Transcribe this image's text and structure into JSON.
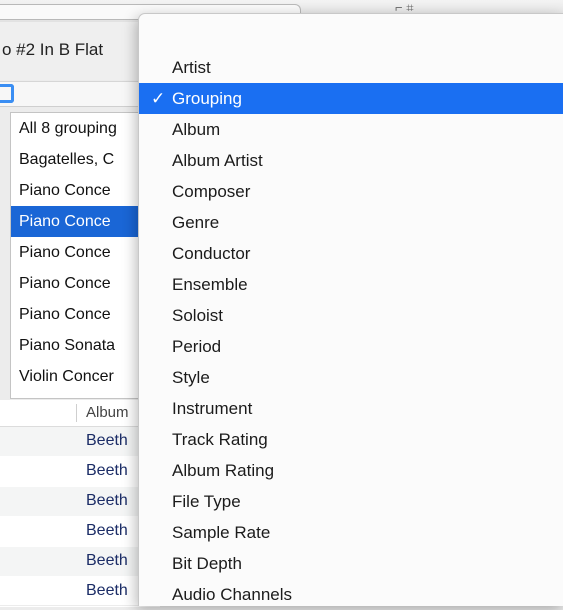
{
  "now_playing": {
    "text": "o #2 In B Flat"
  },
  "grouping_list": {
    "items": [
      {
        "label": "All 8 grouping",
        "selected": false
      },
      {
        "label": "Bagatelles, C",
        "selected": false
      },
      {
        "label": "Piano Conce",
        "selected": false
      },
      {
        "label": "Piano Conce",
        "selected": true
      },
      {
        "label": "Piano Conce",
        "selected": false
      },
      {
        "label": "Piano Conce",
        "selected": false
      },
      {
        "label": "Piano Conce",
        "selected": false
      },
      {
        "label": "Piano Sonata",
        "selected": false
      },
      {
        "label": "Violin Concer",
        "selected": false
      }
    ]
  },
  "tracks": {
    "column_header": "Album",
    "rows": [
      "Beeth",
      "Beeth",
      "Beeth",
      "Beeth",
      "Beeth",
      "Beeth"
    ]
  },
  "menu": {
    "check_glyph": "✓",
    "items": [
      {
        "label": "Artist",
        "checked": false
      },
      {
        "label": "Grouping",
        "checked": true
      },
      {
        "label": "Album",
        "checked": false
      },
      {
        "label": "Album Artist",
        "checked": false
      },
      {
        "label": "Composer",
        "checked": false
      },
      {
        "label": "Genre",
        "checked": false
      },
      {
        "label": "Conductor",
        "checked": false
      },
      {
        "label": "Ensemble",
        "checked": false
      },
      {
        "label": "Soloist",
        "checked": false
      },
      {
        "label": "Period",
        "checked": false
      },
      {
        "label": "Style",
        "checked": false
      },
      {
        "label": "Instrument",
        "checked": false
      },
      {
        "label": "Track Rating",
        "checked": false
      },
      {
        "label": "Album Rating",
        "checked": false
      },
      {
        "label": "File Type",
        "checked": false
      },
      {
        "label": "Sample Rate",
        "checked": false
      },
      {
        "label": "Bit Depth",
        "checked": false
      },
      {
        "label": "Audio Channels",
        "checked": false
      }
    ]
  },
  "colors": {
    "selection": "#1a66d6",
    "menu_highlight": "#1a6ff2",
    "focus_ring": "#3a8ef3",
    "track_text": "#1b2c66"
  }
}
